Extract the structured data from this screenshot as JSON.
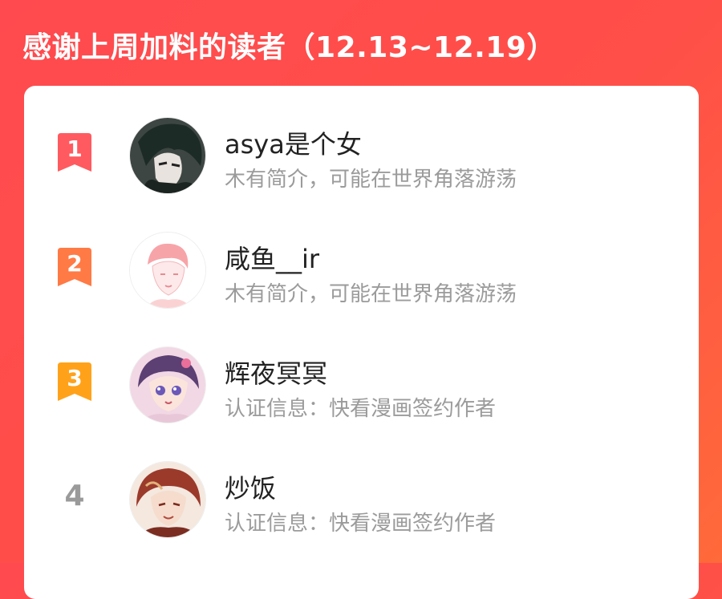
{
  "header": {
    "title": "感谢上周加料的读者（12.13~12.19）"
  },
  "colors": {
    "background": "#ff4f48",
    "rank1": "#ff5a5f",
    "rank2": "#ff7a45",
    "rank3": "#ffa21a",
    "rank_plain": "#9a9a9a"
  },
  "readers": [
    {
      "rank": "1",
      "name": "asya是个女",
      "desc": "木有简介，可能在世界角落游荡",
      "avatar_icon": "dark-hair-anime-avatar"
    },
    {
      "rank": "2",
      "name": "咸鱼__ir",
      "desc": "木有简介，可能在世界角落游荡",
      "avatar_icon": "pink-sketch-avatar"
    },
    {
      "rank": "3",
      "name": "辉夜冥冥",
      "desc": "认证信息：快看漫画签约作者",
      "avatar_icon": "purple-hair-girl-avatar"
    },
    {
      "rank": "4",
      "name": "炒饭",
      "desc": "认证信息：快看漫画签约作者",
      "avatar_icon": "red-hair-avatar"
    }
  ]
}
